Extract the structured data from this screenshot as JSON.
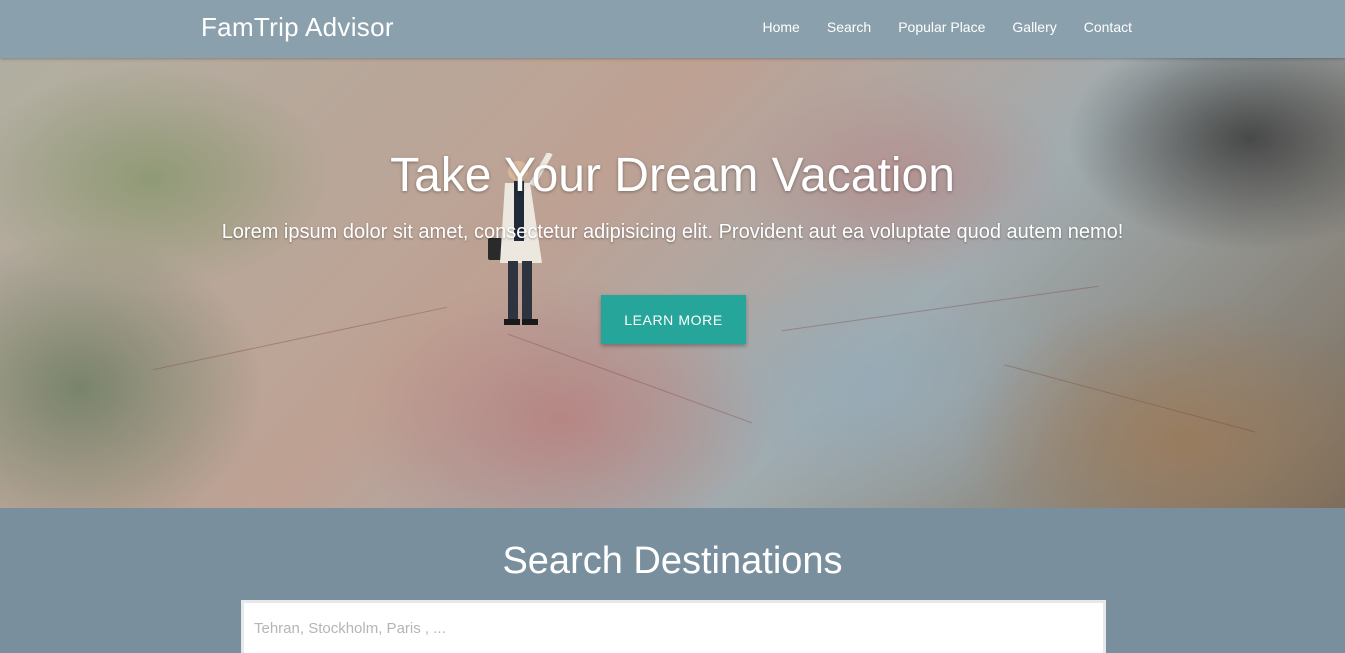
{
  "navbar": {
    "brand": "FamTrip Advisor",
    "links": [
      "Home",
      "Search",
      "Popular Place",
      "Gallery",
      "Contact"
    ]
  },
  "hero": {
    "title": "Take Your Dream Vacation",
    "subtitle": "Lorem ipsum dolor sit amet, consectetur adipisicing elit. Provident aut ea voluptate quod autem nemo!",
    "button_label": "LEARN MORE"
  },
  "search": {
    "title": "Search Destinations",
    "placeholder": "Tehran, Stockholm, Paris , ..."
  },
  "colors": {
    "navbar": "#8aa0ad",
    "accent": "#26a69a",
    "section_bg": "#7a8f9d"
  }
}
